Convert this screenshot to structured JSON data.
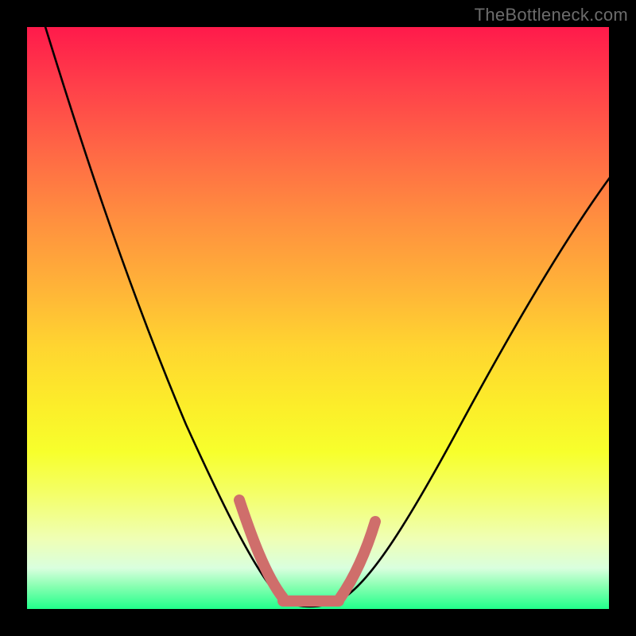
{
  "watermark": "TheBottleneck.com",
  "chart_data": {
    "type": "line",
    "title": "",
    "xlabel": "",
    "ylabel": "",
    "xlim": [
      0,
      100
    ],
    "ylim": [
      0,
      100
    ],
    "series": [
      {
        "name": "bottleneck-curve",
        "x": [
          2,
          6,
          10,
          14,
          18,
          22,
          26,
          30,
          34,
          37,
          40,
          43,
          46,
          49,
          52,
          55,
          60,
          66,
          72,
          78,
          84,
          90,
          96,
          100
        ],
        "values": [
          100,
          92,
          84,
          76,
          68,
          59,
          50,
          41,
          32,
          24,
          17,
          10,
          5,
          2,
          1,
          2,
          5,
          12,
          21,
          31,
          42,
          53,
          63,
          70
        ]
      }
    ],
    "highlight": {
      "name": "optimal-range-marker",
      "color": "#cf6e6b",
      "x": [
        37,
        40,
        43,
        46,
        49,
        52,
        55,
        58
      ],
      "values": [
        20,
        12,
        6,
        2,
        1,
        1,
        4,
        10
      ]
    }
  }
}
